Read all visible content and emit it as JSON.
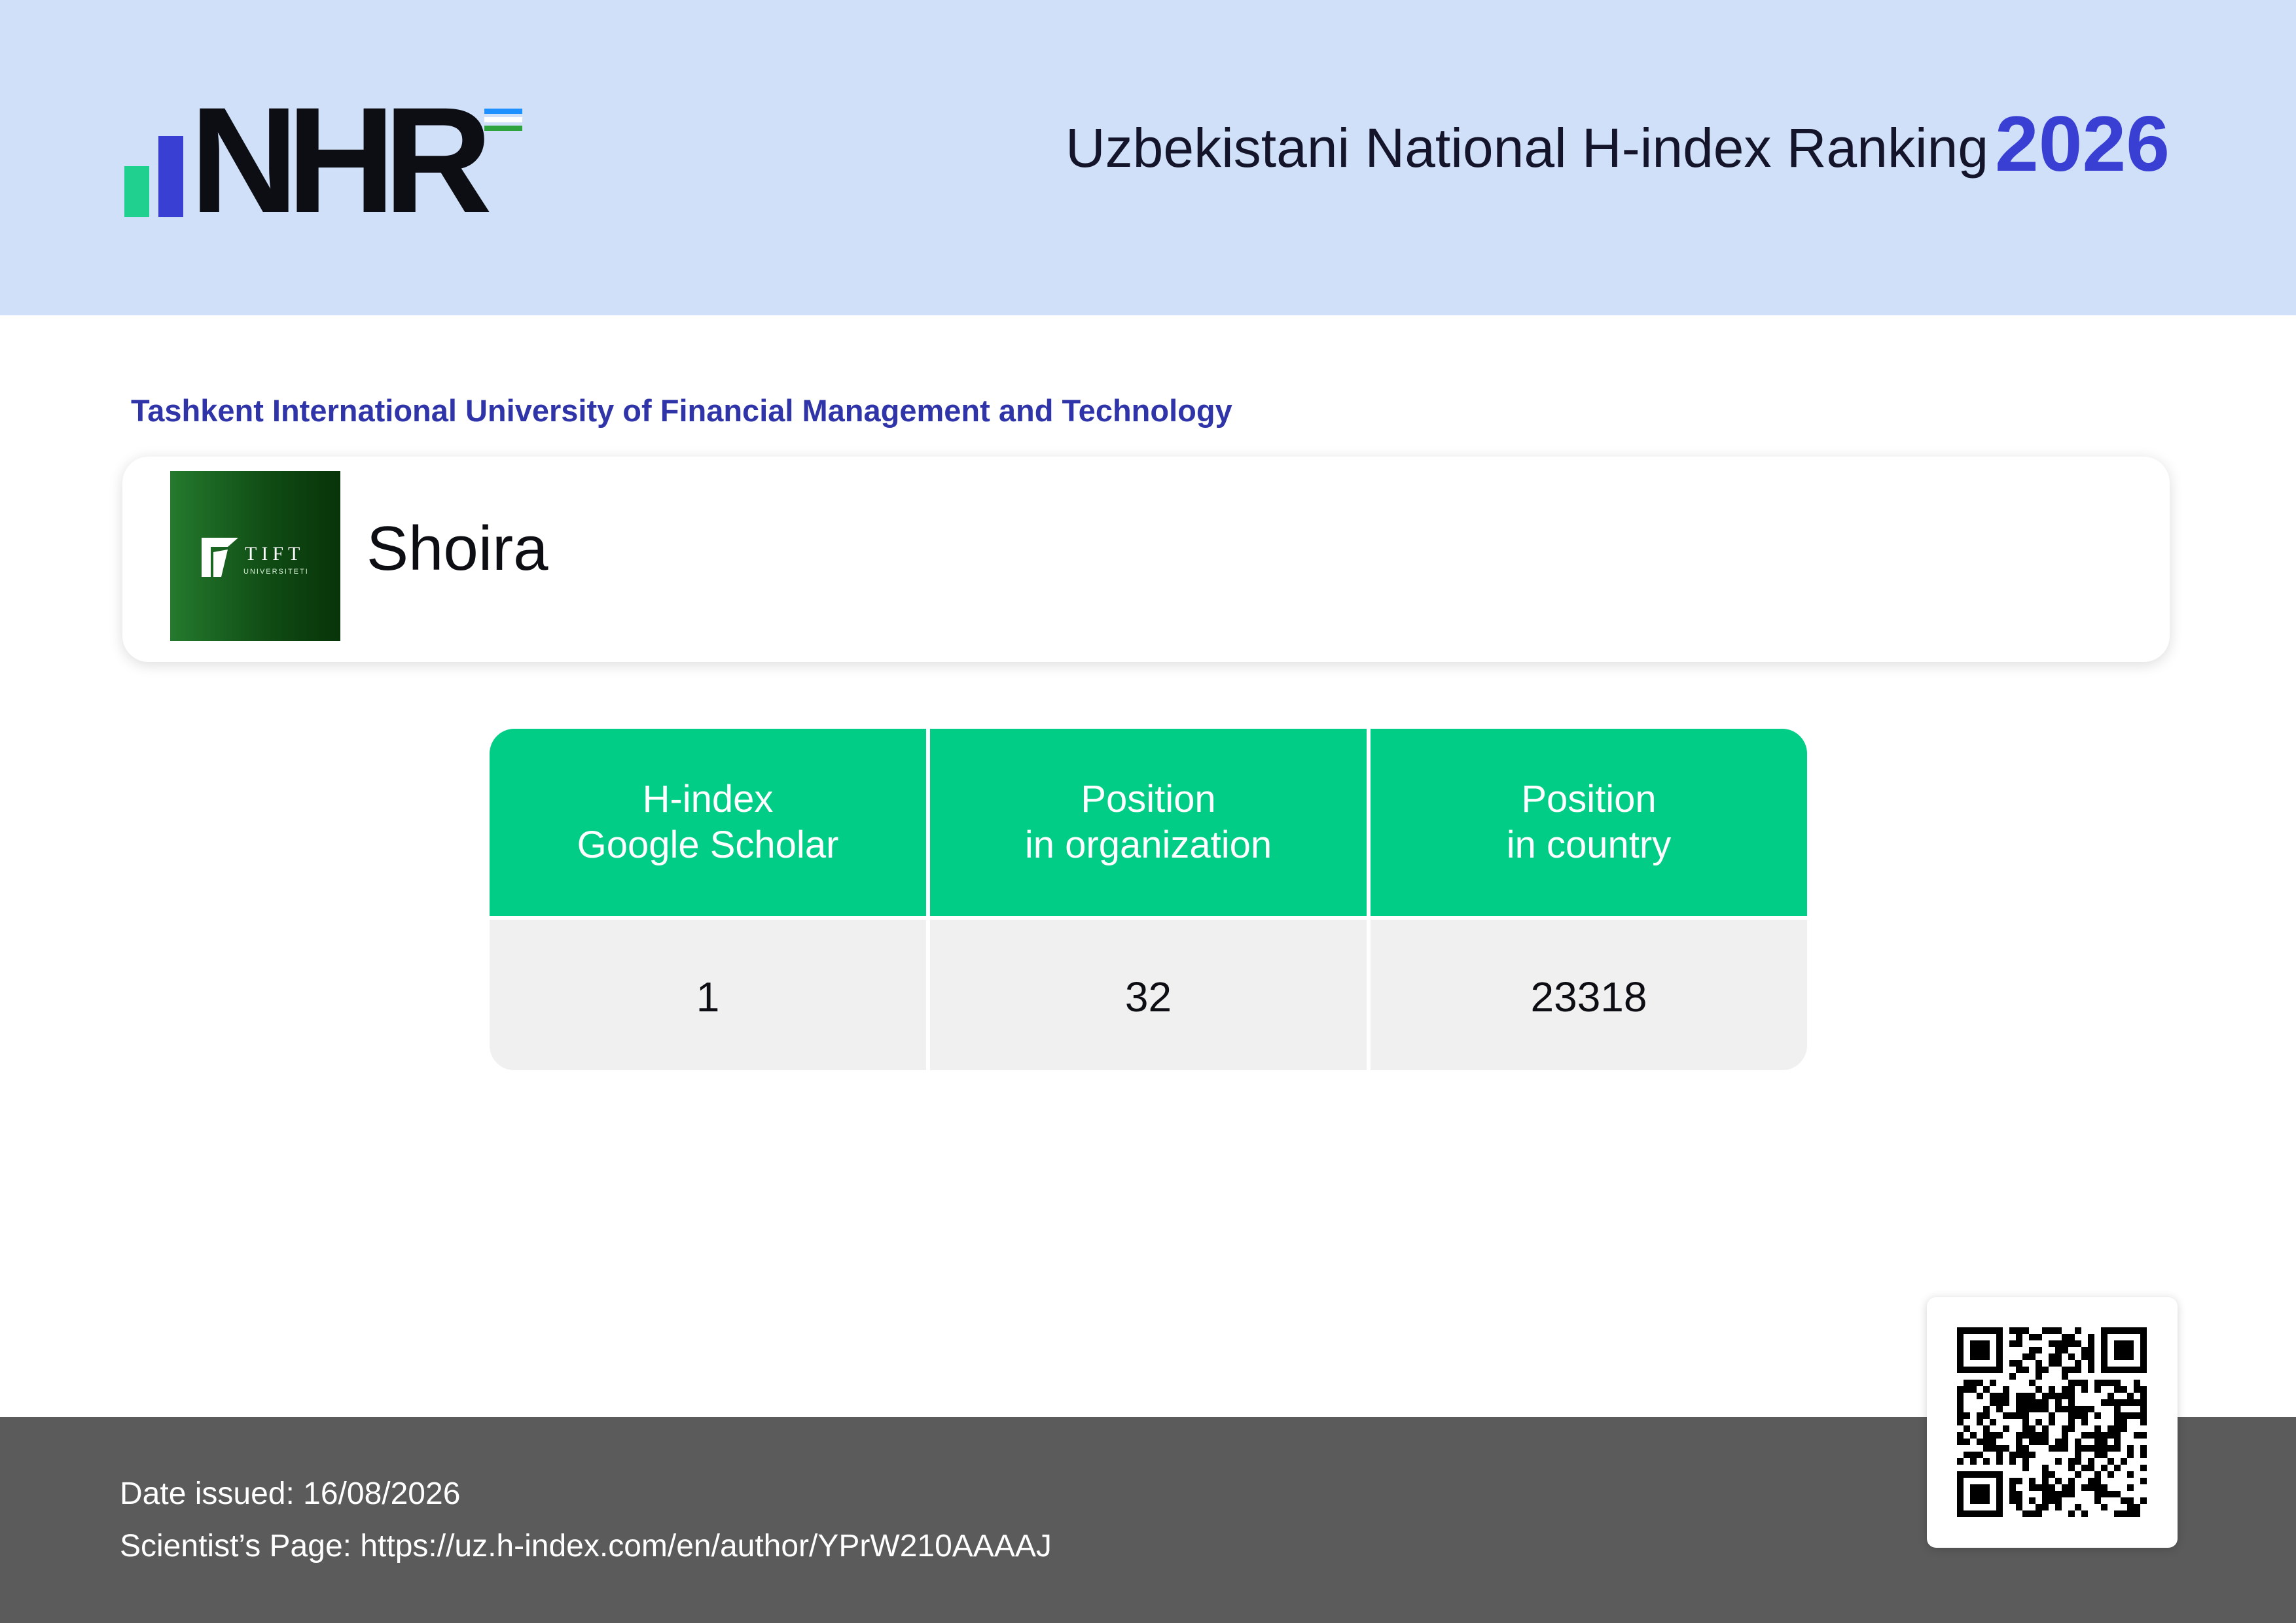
{
  "header": {
    "logo_text": "NHR",
    "title": "Uzbekistani National H-index Ranking",
    "year": "2026"
  },
  "organization": {
    "name": "Tashkent International University of Financial Management and Technology",
    "logo_text": "TIFT",
    "logo_subtext": "UNIVERSITETI"
  },
  "scientist": {
    "name": "Shoira"
  },
  "stats": [
    {
      "label_line1": "H-index",
      "label_line2": "Google Scholar",
      "value": "1"
    },
    {
      "label_line1": "Position",
      "label_line2": "in organization",
      "value": "32"
    },
    {
      "label_line1": "Position",
      "label_line2": "in country",
      "value": "23318"
    }
  ],
  "footer": {
    "date_label": "Date issued:",
    "date": "16/08/2026",
    "page_label": "Scientist’s Page:",
    "url": "https://uz.h-index.com/en/author/YPrW210AAAAJ"
  },
  "colors": {
    "header_bg": "#cfe0f8",
    "accent_blue": "#3a3fd4",
    "accent_green": "#02cd86",
    "footer_bg": "#5b5b5b"
  }
}
